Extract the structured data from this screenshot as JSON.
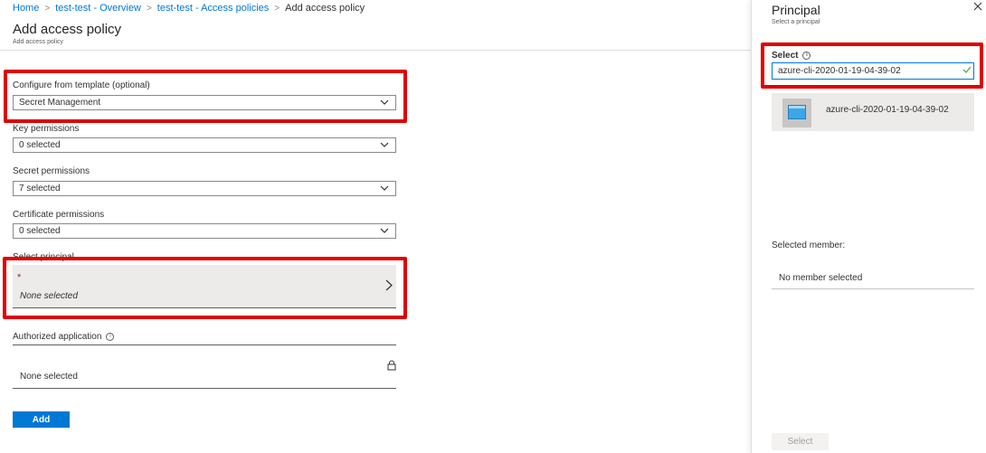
{
  "breadcrumb": [
    {
      "label": "Home"
    },
    {
      "label": "test-test - Overview"
    },
    {
      "label": "test-test - Access policies"
    },
    {
      "label": "Add access policy"
    }
  ],
  "page": {
    "title": "Add access policy",
    "subtitle": "Add access policy"
  },
  "form": {
    "template_label": "Configure from template (optional)",
    "template_value": "Secret Management",
    "key_label": "Key permissions",
    "key_value": "0 selected",
    "secret_label": "Secret permissions",
    "secret_value": "7 selected",
    "cert_label": "Certificate permissions",
    "cert_value": "0 selected",
    "principal_label": "Select principal",
    "principal_required": "*",
    "principal_value": "None selected",
    "auth_label": "Authorized application",
    "auth_value": "None selected",
    "add_button": "Add",
    "info_glyph": "i"
  },
  "panel": {
    "title": "Principal",
    "subtitle": "Select a principal",
    "select_label": "Select",
    "search_value": "azure-cli-2020-01-19-04-39-02",
    "result_name": "azure-cli-2020-01-19-04-39-02",
    "selected_member_label": "Selected member:",
    "no_member": "No member selected",
    "select_button": "Select"
  },
  "colors": {
    "accent": "#0078d4",
    "highlight": "#e00000",
    "required": "#a4262c",
    "valid_check": "#4caf50"
  },
  "icons": {
    "chevron": "chevron-down-icon",
    "chevron_right": "chevron-right-icon",
    "info": "info-icon",
    "lock": "lock-icon",
    "close": "close-icon",
    "check": "check-icon",
    "app": "app-icon"
  }
}
